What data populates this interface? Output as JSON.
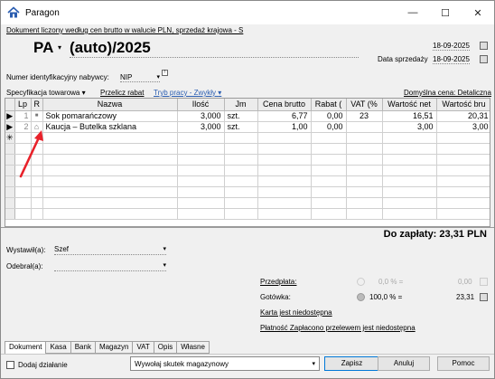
{
  "window": {
    "title": "Paragon",
    "minimize": "—",
    "maximize": "☐",
    "close": "✕"
  },
  "banner": "Dokument liczony według cen brutto w walucie PLN, sprzedaż krajowa - S",
  "header": {
    "doc_type": "PA",
    "doc_type_arrow": "▾",
    "doc_number": "(auto)/2025",
    "date_issued": "18-09-2025",
    "date_sale_label": "Data sprzedaży",
    "date_sale": "18-09-2025"
  },
  "buyer_id": {
    "label": "Numer identyfikacyjny nabywcy:",
    "value": "NIP",
    "arrow": "▾",
    "badge": "!"
  },
  "spec_bar": {
    "spec": "Specyfikacja towarowa",
    "spec_arrow": "▾",
    "recalc": "Przelicz rabat",
    "mode": "Tryb pracy - Zwykły",
    "mode_arrow": "▾",
    "default_price": "Domyślna cena: Detaliczna"
  },
  "table": {
    "headers": [
      "",
      "Lp",
      "R",
      "Nazwa",
      "Ilość",
      "Jm",
      "Cena brutto",
      "Rabat (",
      "VAT (%",
      "Wartość net",
      "Wartość bru"
    ],
    "rows": [
      {
        "marker": "▶",
        "lp": "1",
        "r": "■",
        "name": "Sok pomarańczowy",
        "qty": "3,000",
        "unit": "szt.",
        "price": "6,77",
        "discount": "0,00",
        "vat": "23",
        "net": "16,51",
        "gross": "20,31"
      },
      {
        "marker": "▶",
        "lp": "2",
        "r": "⌂",
        "name": "Kaucja – Butelka szklana",
        "qty": "3,000",
        "unit": "szt.",
        "price": "1,00",
        "discount": "0,00",
        "vat": "",
        "net": "3,00",
        "gross": "3,00"
      },
      {
        "marker": "✳",
        "lp": "",
        "r": "",
        "name": "",
        "qty": "",
        "unit": "",
        "price": "",
        "discount": "",
        "vat": "",
        "net": "",
        "gross": ""
      }
    ],
    "empty_rows": 7
  },
  "to_pay": "Do zapłaty: 23,31 PLN",
  "issued_by": {
    "label": "Wystawił(a):",
    "value": "Szef",
    "arrow": "▾"
  },
  "received_by": {
    "label": "Odebrał(a):",
    "value": "",
    "arrow": "▾"
  },
  "payment": {
    "prepayment_label": "Przedpłata:",
    "prepayment_pct": "0,0 % =",
    "prepayment_amount": "0,00",
    "cash_label": "Gotówka:",
    "cash_pct": "100,0 % =",
    "cash_amount": "23,31",
    "card": "Karta jest niedostępna",
    "transfer": "Płatność Zapłacono przelewem jest niedostępna"
  },
  "tabs": [
    "Dokument",
    "Kasa",
    "Bank",
    "Magazyn",
    "VAT",
    "Opis",
    "Własne"
  ],
  "footer": {
    "add_action": "Dodaj działanie",
    "warehouse_effect": "Wywołaj skutek magazynowy",
    "combo_arrow": "▾",
    "save": "Zapisz",
    "cancel": "Anuluj",
    "help": "Pomoc"
  },
  "colors": {
    "accent": "#0078d7",
    "link": "#2a5db0",
    "annotation_arrow": "#e8212a"
  }
}
